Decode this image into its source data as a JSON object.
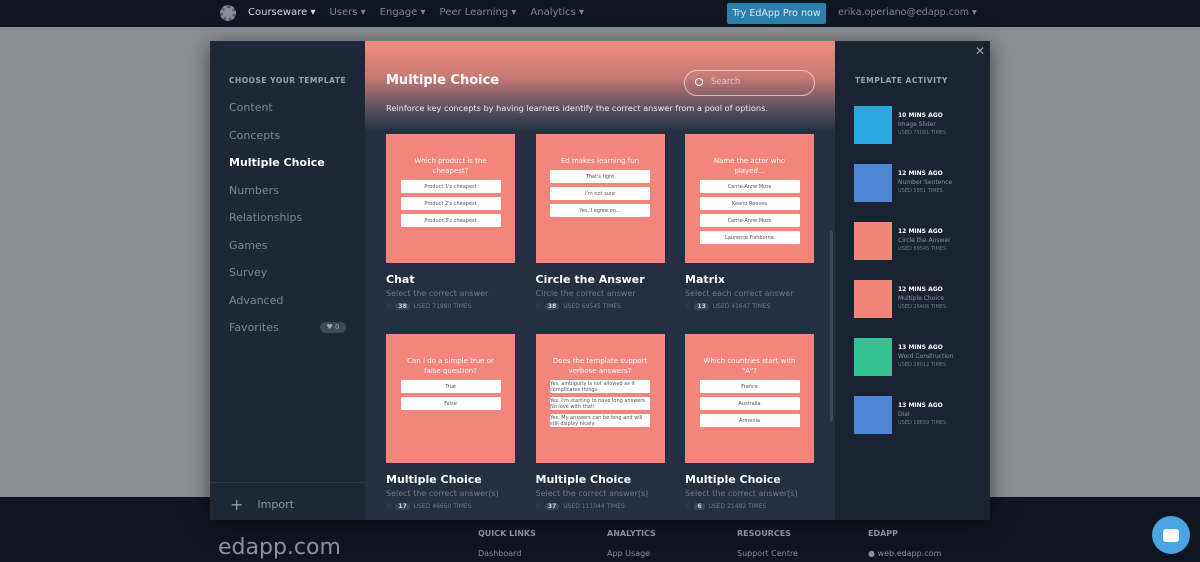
{
  "nav": {
    "items": [
      "Courseware ▾",
      "Users ▾",
      "Engage ▾",
      "Peer Learning ▾",
      "Analytics ▾"
    ],
    "pro_button": "Try EdApp Pro now",
    "user": "erika.operiano@edapp.com ▾"
  },
  "sidebar": {
    "heading": "CHOOSE YOUR TEMPLATE",
    "items": [
      "Content",
      "Concepts",
      "Multiple Choice",
      "Numbers",
      "Relationships",
      "Games",
      "Survey",
      "Advanced",
      "Favorites"
    ],
    "active": "Multiple Choice",
    "favorites_badge": "♥ 0",
    "import": "Import"
  },
  "main": {
    "title": "Multiple Choice",
    "description": "Reinforce key concepts by having learners identify the correct answer from a pool of options.",
    "search_placeholder": "Search",
    "cards": [
      {
        "title": "Chat",
        "subtitle": "Select the correct answer",
        "likes": "38",
        "usage": "USED 71980 TIMES",
        "preview": {
          "question": "Which product is the cheapest?",
          "options": [
            "Product 1's cheapest",
            "Product 2's cheapest",
            "Product 3's cheapest"
          ]
        }
      },
      {
        "title": "Circle the Answer",
        "subtitle": "Circle the correct answer",
        "likes": "38",
        "usage": "USED 69545 TIMES",
        "preview": {
          "question": "Ed makes learning fun",
          "options": [
            "That's right",
            "I'm not sure",
            "Yes, I agree on..."
          ]
        }
      },
      {
        "title": "Matrix",
        "subtitle": "Select each correct answer",
        "likes": "13",
        "usage": "USED 41647 TIMES",
        "preview": {
          "question": "Name the actor who played...",
          "options": [
            "Carrie-Anne Moss",
            "Keanu Reeves",
            "Carrie-Anne Moss",
            "Laurence Fishburne"
          ]
        }
      },
      {
        "title": "Multiple Choice",
        "subtitle": "Select the correct answer(s)",
        "likes": "17",
        "usage": "USED 46650 TIMES",
        "preview": {
          "question": "Can I do a simple true or false question?",
          "options": [
            "True",
            "False"
          ]
        }
      },
      {
        "title": "Multiple Choice",
        "subtitle": "Select the correct answer(s)",
        "likes": "37",
        "usage": "USED 111044 TIMES",
        "preview": {
          "question": "Does the template support verbose answers?",
          "options": [
            "Yes, ambiguity is not allowed as it complicates things.",
            "Yes, I'm starting to have long answers. No love with that!",
            "Yes, My answers can be long and will still display nicely."
          ]
        }
      },
      {
        "title": "Multiple Choice",
        "subtitle": "Select the correct answer(s)",
        "likes": "6",
        "usage": "USED 21492 TIMES",
        "preview": {
          "question": "Which countries start with \"A\"?",
          "options": [
            "France",
            "Australia",
            "Armenia"
          ]
        }
      }
    ]
  },
  "activity": {
    "heading": "TEMPLATE ACTIVITY",
    "items": [
      {
        "time": "10 MINS AGO",
        "name": "Image Slider",
        "usage": "USED 75081 TIMES",
        "color": "#2aa8e0"
      },
      {
        "time": "12 MINS AGO",
        "name": "Number Sentence",
        "usage": "USED 5851 TIMES",
        "color": "#4f86d4"
      },
      {
        "time": "12 MINS AGO",
        "name": "Circle the Answer",
        "usage": "USED 69545 TIMES",
        "color": "#f2857a"
      },
      {
        "time": "12 MINS AGO",
        "name": "Multiple Choice",
        "usage": "USED 26406 TIMES",
        "color": "#f2857a"
      },
      {
        "time": "13 MINS AGO",
        "name": "Word Construction",
        "usage": "USED 28012 TIMES",
        "color": "#35c092"
      },
      {
        "time": "13 MINS AGO",
        "name": "Dial",
        "usage": "USED 18659 TIMES",
        "color": "#4f86d4"
      }
    ]
  },
  "footer": {
    "brand": "edapp.com",
    "columns": [
      {
        "heading": "QUICK LINKS",
        "link": "Dashboard"
      },
      {
        "heading": "ANALYTICS",
        "link": "App Usage"
      },
      {
        "heading": "RESOURCES",
        "link": "Support Centre"
      },
      {
        "heading": "EDAPP",
        "link": "● web.edapp.com"
      }
    ]
  }
}
